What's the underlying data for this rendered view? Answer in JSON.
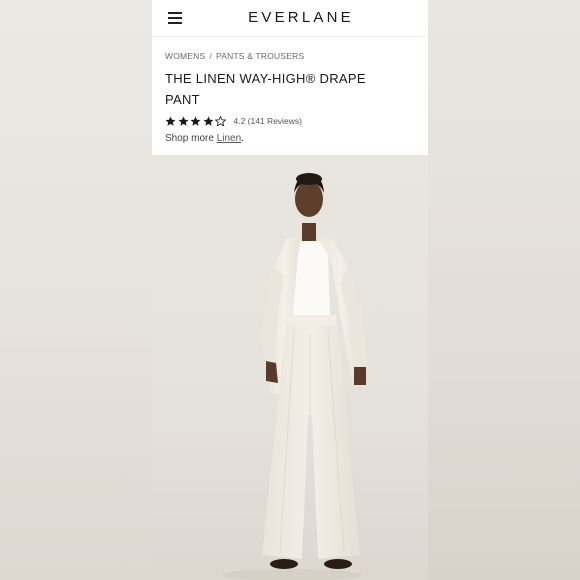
{
  "header": {
    "logo_text": "EVERLANE",
    "menu_icon": "hamburger-menu-icon"
  },
  "breadcrumb": {
    "items": [
      "WOMENS",
      "PANTS & TROUSERS"
    ],
    "separator": "/"
  },
  "product": {
    "title": "THE LINEN WAY-HIGH® DRAPE PANT",
    "rating_value": 4.2,
    "rating_text": "4.2 (141 Reviews)",
    "stars": {
      "filled": 4,
      "total": 5,
      "icon": "star-icon"
    },
    "shop_more_prefix": "Shop more ",
    "shop_more_link": "Linen",
    "shop_more_suffix": ".",
    "image": {
      "alt": "Model wearing white linen shirt, white tank top and white wide-leg drape pants",
      "background_color": "#e6e2dc"
    }
  },
  "colors": {
    "text_primary": "#1a1a1a",
    "text_secondary": "#6b6b6b",
    "page_background": "#ffffff"
  }
}
